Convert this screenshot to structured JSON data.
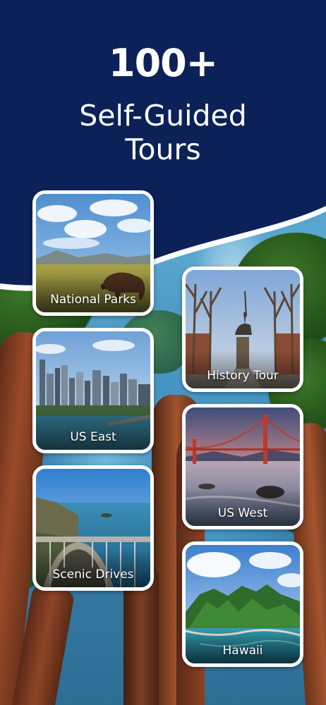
{
  "header": {
    "count": "100+",
    "line1": "Self-Guided",
    "line2": "Tours"
  },
  "colors": {
    "header_background": "#0b2157",
    "card_border": "#ffffff",
    "text": "#ffffff"
  },
  "tours": [
    {
      "label": "National Parks",
      "image": "bison-in-grassland-scene"
    },
    {
      "label": "History Tour",
      "image": "equestrian-statue-tree-lined-path"
    },
    {
      "label": "US East",
      "image": "city-skyline-waterfront"
    },
    {
      "label": "US West",
      "image": "golden-gate-bridge-sunset"
    },
    {
      "label": "Scenic Drives",
      "image": "coastal-arch-bridge"
    },
    {
      "label": "Hawaii",
      "image": "green-mountains-island-coast"
    }
  ]
}
